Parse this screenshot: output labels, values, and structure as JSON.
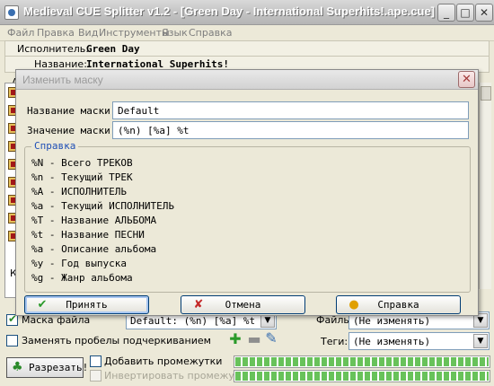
{
  "window": {
    "title": "Medieval CUE Splitter v1.2 - [Green Day - International Superhits!.ape.cue]",
    "min_glyph": "_",
    "max_glyph": "□",
    "close_glyph": "✕"
  },
  "menu": [
    "Файл",
    "Правка",
    "Вид",
    "Инструменты",
    "Язык",
    "Справка"
  ],
  "info": {
    "artist_label": "Исполнитель:",
    "artist_value": "Green Day",
    "album_label": "Название:",
    "album_value": "International Superhits!"
  },
  "background": {
    "col_letter": "A",
    "row_letter": "К"
  },
  "dialog": {
    "title": "Изменить маску",
    "close_glyph": "✕",
    "mask_name_label": "Название маски:",
    "mask_name_value": "Default",
    "mask_value_label": "Значение маски:",
    "mask_value_value": "(%n) [%a] %t",
    "help_legend": "Справка",
    "help_lines": [
      "%N - Всего ТРЕКОВ",
      "%n - Текущий ТРЕК",
      "%A - ИСПОЛНИТЕЛЬ",
      "%a - Текущий ИСПОЛНИТЕЛЬ",
      "%T - Название АЛЬБОМА",
      "%t - Название ПЕСНИ",
      "%a - Описание альбома",
      "%y - Год выпуска",
      "%g - Жанр альбома"
    ],
    "buttons": {
      "accept": "Принять",
      "cancel": "Отмена",
      "help": "Справка"
    }
  },
  "bottom": {
    "mask_file_label": "Маска файла",
    "mask_file_checked": true,
    "mask_file_value": "Default: (%n) [%a] %t",
    "files_label": "Файлы:",
    "files_value": "(Не изменять)",
    "replace_spaces_label": "Заменять пробелы подчеркиванием",
    "replace_spaces_checked": false,
    "tags_label": "Теги:",
    "tags_value": "(Не изменять)",
    "split_button": "Разрезать!",
    "add_gaps_label": "Добавить промежутки",
    "add_gaps_checked": false,
    "invert_gaps_label": "Инвертировать промежутки",
    "invert_gaps_checked": false,
    "progress_top": 1.0,
    "progress_bottom": 1.0
  },
  "colors": {
    "legend": "#1f4fb6",
    "progress": "#68c25a",
    "accent_border": "#003c74"
  }
}
